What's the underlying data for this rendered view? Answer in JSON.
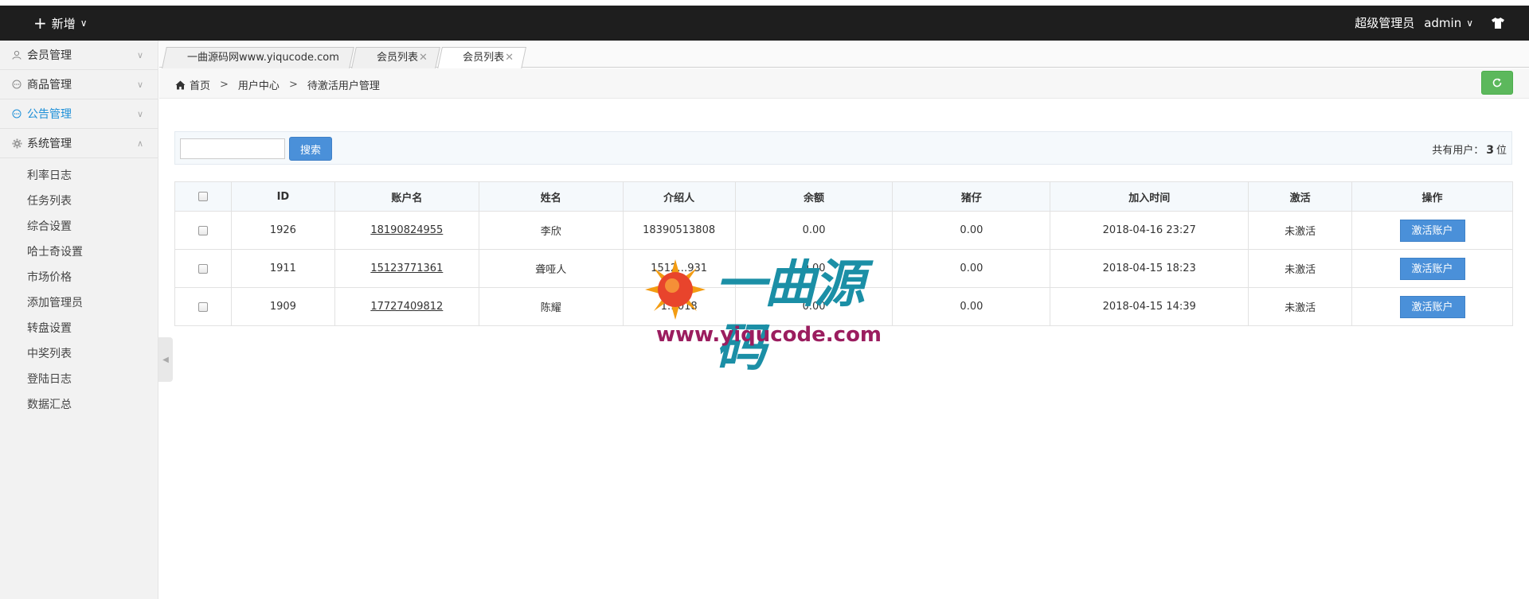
{
  "topbar": {
    "add_label": "新增",
    "role": "超级管理员",
    "username": "admin"
  },
  "sidebar": {
    "groups": [
      {
        "label": "会员管理",
        "icon": "user-icon"
      },
      {
        "label": "商品管理",
        "icon": "chat-icon"
      },
      {
        "label": "公告管理",
        "icon": "chat-icon",
        "active": true
      },
      {
        "label": "系统管理",
        "icon": "gear-icon",
        "expanded": true
      }
    ],
    "subitems": [
      "利率日志",
      "任务列表",
      "综合设置",
      "哈士奇设置",
      "市场价格",
      "添加管理员",
      "转盘设置",
      "中奖列表",
      "登陆日志",
      "数据汇总"
    ]
  },
  "tabs": [
    {
      "label": "一曲源码网www.yiqucode.com"
    },
    {
      "label": "会员列表"
    },
    {
      "label": "会员列表",
      "active": true
    }
  ],
  "breadcrumb": [
    "首页",
    "用户中心",
    "待激活用户管理"
  ],
  "toolbar": {
    "search_value": "",
    "search_label": "搜索",
    "count_prefix": "共有用户：",
    "count": "3",
    "count_suffix": "位"
  },
  "table": {
    "headers": [
      "ID",
      "账户名",
      "姓名",
      "介绍人",
      "余额",
      "猪仔",
      "加入时间",
      "激活",
      "操作"
    ],
    "rows": [
      {
        "id": "1926",
        "account": "18190824955",
        "name": "李欣",
        "referrer": "18390513808",
        "balance": "0.00",
        "piglets": "0.00",
        "joined": "2018-04-16 23:27",
        "status": "未激活",
        "action": "激活账户"
      },
      {
        "id": "1911",
        "account": "15123771361",
        "name": "聋哑人",
        "referrer": "1512…931",
        "balance": "0.00",
        "piglets": "0.00",
        "joined": "2018-04-15 18:23",
        "status": "未激活",
        "action": "激活账户"
      },
      {
        "id": "1909",
        "account": "17727409812",
        "name": "陈耀",
        "referrer": "1…018",
        "balance": "0.00",
        "piglets": "0.00",
        "joined": "2018-04-15 14:39",
        "status": "未激活",
        "action": "激活账户"
      }
    ]
  },
  "watermark": {
    "title": "一曲源码",
    "url": "www.yiqucode.com"
  },
  "colors": {
    "topbar": "#1e1e1e",
    "accent_blue": "#4a90d9",
    "refresh_green": "#5cb85c",
    "active_menu": "#1e90d8"
  }
}
